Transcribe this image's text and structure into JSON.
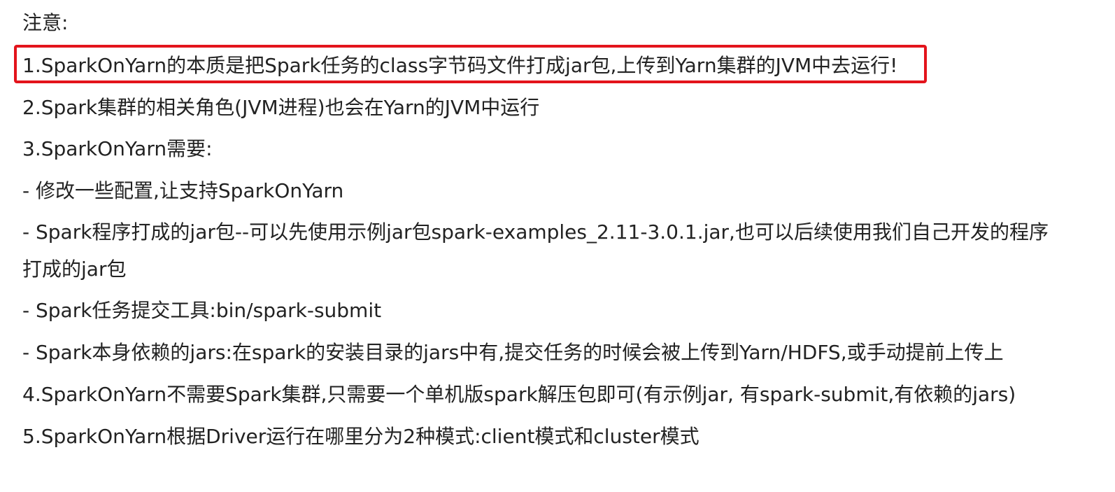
{
  "note_heading": "注意:",
  "highlight_color": "#e3141c",
  "items": [
    "1.SparkOnYarn的本质是把Spark任务的class字节码文件打成jar包,上传到Yarn集群的JVM中去运行!",
    "2.Spark集群的相关角色(JVM进程)也会在Yarn的JVM中运行",
    "3.SparkOnYarn需要:",
    "- 修改一些配置,让支持SparkOnYarn",
    "- Spark程序打成的jar包--可以先使用示例jar包spark-examples_2.11-3.0.1.jar,也可以后续使用我们自己开发的程序",
    "打成的jar包",
    "- Spark任务提交工具:bin/spark-submit",
    "- Spark本身依赖的jars:在spark的安装目录的jars中有,提交任务的时候会被上传到Yarn/HDFS,或手动提前上传上",
    "4.SparkOnYarn不需要Spark集群,只需要一个单机版spark解压包即可(有示例jar, 有spark-submit,有依赖的jars)",
    "5.SparkOnYarn根据Driver运行在哪里分为2种模式:client模式和cluster模式"
  ]
}
